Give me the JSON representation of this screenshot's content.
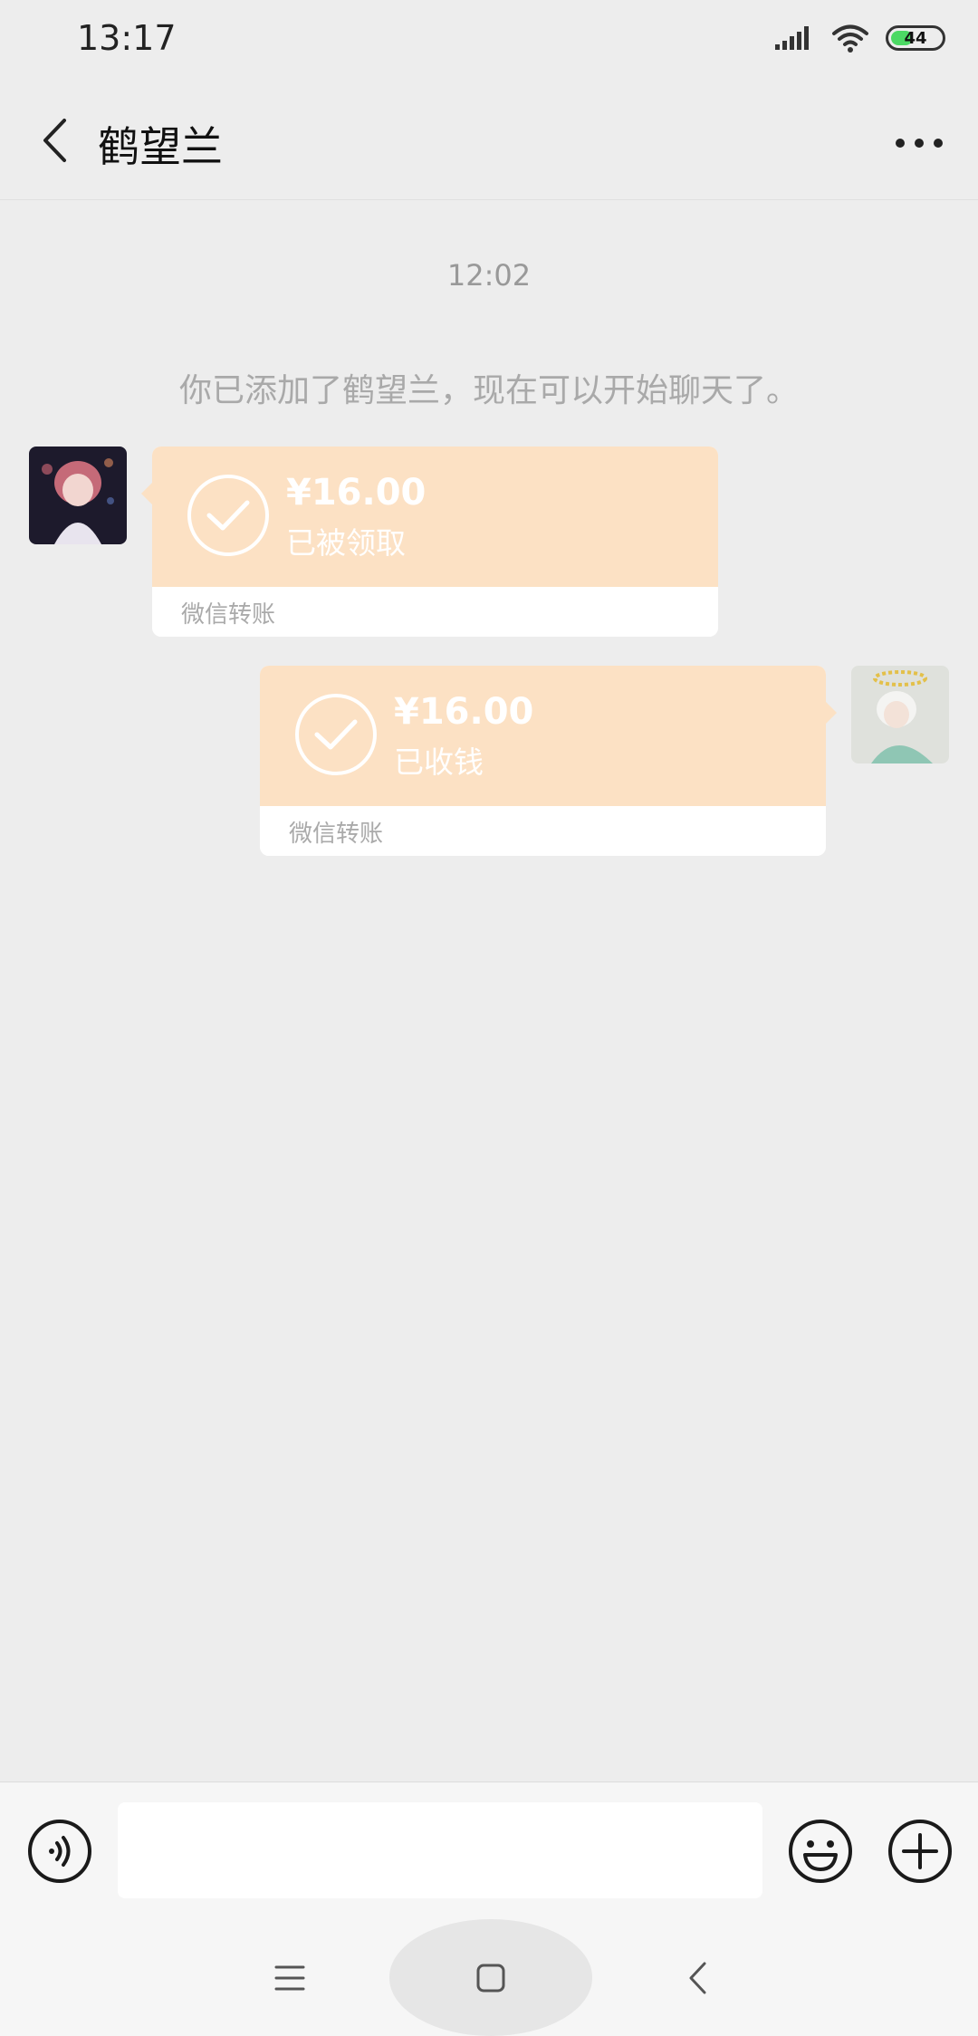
{
  "status_bar": {
    "time": "13:17",
    "battery": "44"
  },
  "header": {
    "title": "鹤望兰"
  },
  "chat": {
    "timestamp": "12:02",
    "system_message": "你已添加了鹤望兰，现在可以开始聊天了。",
    "messages": [
      {
        "side": "left",
        "amount": "¥16.00",
        "status": "已被领取",
        "label": "微信转账"
      },
      {
        "side": "right",
        "amount": "¥16.00",
        "status": "已收钱",
        "label": "微信转账"
      }
    ]
  },
  "input": {
    "value": "",
    "placeholder": ""
  },
  "colors": {
    "card": "#fce1c4",
    "background": "#ededed"
  }
}
